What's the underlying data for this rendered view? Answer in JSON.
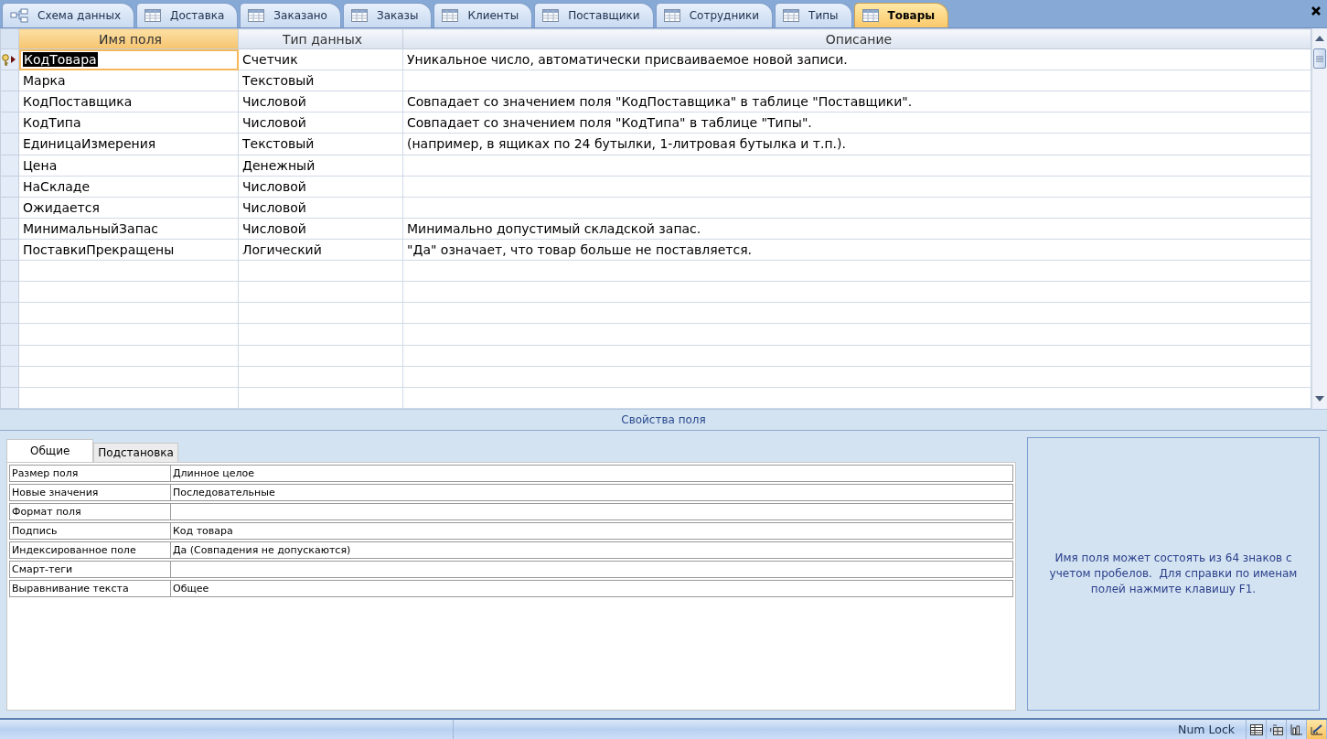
{
  "tabs": [
    {
      "label": "Схема данных",
      "kind": "diagram",
      "selected": false
    },
    {
      "label": "Доставка",
      "kind": "table",
      "selected": false
    },
    {
      "label": "Заказано",
      "kind": "table",
      "selected": false
    },
    {
      "label": "Заказы",
      "kind": "table",
      "selected": false
    },
    {
      "label": "Клиенты",
      "kind": "table",
      "selected": false
    },
    {
      "label": "Поставщики",
      "kind": "table",
      "selected": false
    },
    {
      "label": "Сотрудники",
      "kind": "table",
      "selected": false
    },
    {
      "label": "Типы",
      "kind": "table",
      "selected": false
    },
    {
      "label": "Товары",
      "kind": "table",
      "selected": true
    }
  ],
  "grid": {
    "columns": [
      {
        "label": "Имя поля",
        "selected": true
      },
      {
        "label": "Тип данных",
        "selected": false
      },
      {
        "label": "Описание",
        "selected": false
      }
    ],
    "rows": [
      {
        "name": "КодТовара",
        "type": "Счетчик",
        "description": "Уникальное число, автоматически присваиваемое новой записи.",
        "primary_key": true,
        "current": true
      },
      {
        "name": "Марка",
        "type": "Текстовый",
        "primary_key": false,
        "current": false
      },
      {
        "name": "КодПоставщика",
        "type": "Числовой",
        "description": "Совпадает со значением поля \"КодПоставщика\" в таблице \"Поставщики\".",
        "primary_key": false,
        "current": false
      },
      {
        "name": "КодТипа",
        "type": "Числовой",
        "description": "Совпадает со значением поля \"КодТипа\" в таблице \"Типы\".",
        "primary_key": false,
        "current": false
      },
      {
        "name": "ЕдиницаИзмерения",
        "type": "Текстовый",
        "description": "(например, в ящиках по 24 бутылки, 1-литровая бутылка и т.п.).",
        "primary_key": false,
        "current": false
      },
      {
        "name": "Цена",
        "type": "Денежный",
        "primary_key": false,
        "current": false
      },
      {
        "name": "НаСкладе",
        "type": "Числовой",
        "primary_key": false,
        "current": false
      },
      {
        "name": "Ожидается",
        "type": "Числовой",
        "primary_key": false,
        "current": false
      },
      {
        "name": "МинимальныйЗапас",
        "type": "Числовой",
        "description": "Минимально допустимый складской запас.",
        "primary_key": false,
        "current": false
      },
      {
        "name": "ПоставкиПрекращены",
        "type": "Логический",
        "description": "\"Да\" означает, что товар больше не поставляется.",
        "primary_key": false,
        "current": false
      }
    ]
  },
  "field_properties": {
    "title": "Свойства поля",
    "tabs": [
      {
        "label": "Общие",
        "selected": true
      },
      {
        "label": "Подстановка",
        "selected": false
      }
    ],
    "properties": [
      {
        "name": "Размер поля",
        "value": "Длинное целое"
      },
      {
        "name": "Новые значения",
        "value": "Последовательные"
      },
      {
        "name": "Формат поля"
      },
      {
        "name": "Подпись",
        "value": "Код товара"
      },
      {
        "name": "Индексированное поле",
        "value": "Да (Совпадения не допускаются)"
      },
      {
        "name": "Смарт-теги"
      },
      {
        "name": "Выравнивание текста",
        "value": "Общее"
      }
    ],
    "help": "Имя поля может состоять из 64 знаков с учетом пробелов.  Для справки по именам полей нажмите клавишу F1."
  },
  "status_bar": {
    "indicator": "Num Lock",
    "views": [
      {
        "kind": "datasheet",
        "selected": false
      },
      {
        "kind": "pivot-table",
        "selected": false
      },
      {
        "kind": "pivot-chart",
        "selected": false
      },
      {
        "kind": "design",
        "selected": true
      }
    ]
  }
}
